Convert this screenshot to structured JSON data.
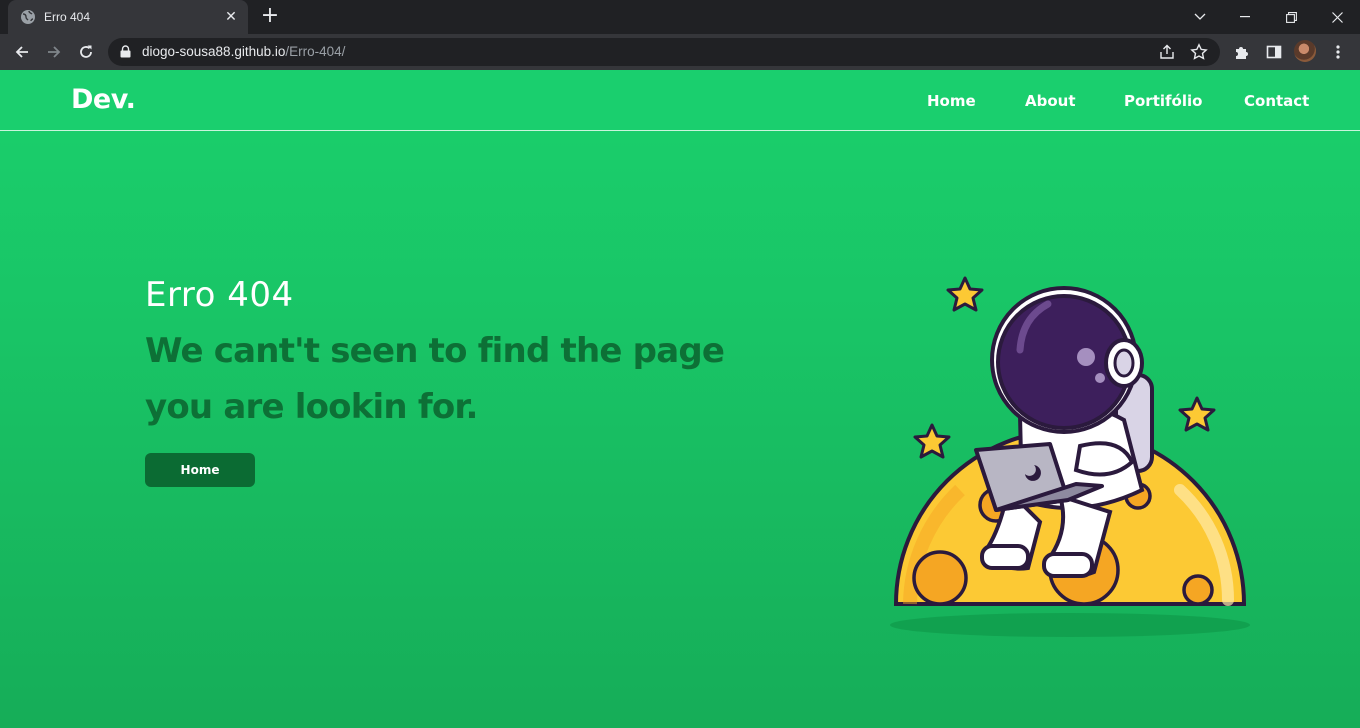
{
  "browser": {
    "tab_title": "Erro 404",
    "url_host": "diogo-sousa88.github.io",
    "url_path": "/Erro-404/"
  },
  "site": {
    "logo": "Dev.",
    "nav": [
      "Home",
      "About",
      "Portifólio",
      "Contact"
    ]
  },
  "error": {
    "title": "Erro 404",
    "message": "We cant't seen to find the page you are lookin for.",
    "button_label": "Home"
  },
  "colors": {
    "page_background": "#19c466",
    "message_text": "#0d7036",
    "button_background": "#0b6b33",
    "moon": "#fcc934"
  }
}
